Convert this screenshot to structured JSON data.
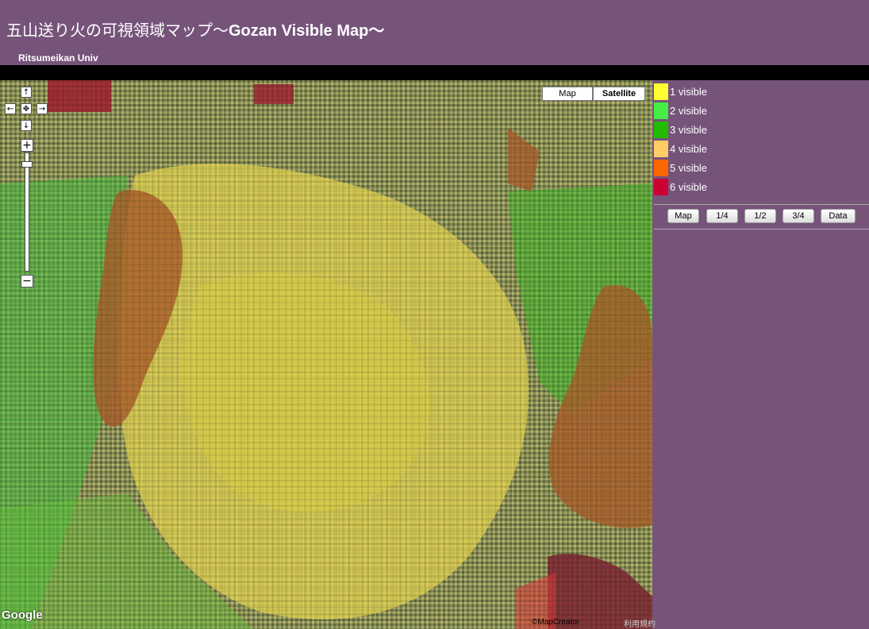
{
  "header": {
    "title_jp": "五山送り火の可視領域マップ〜",
    "title_en": "Gozan Visible Map〜",
    "subtitle": "Ritsumeikan Univ"
  },
  "map": {
    "type_buttons": [
      "Map",
      "Satellite"
    ],
    "selected_type": "Satellite",
    "pan_up_icon": "↑",
    "pan_down_icon": "↓",
    "pan_left_icon": "←",
    "pan_right_icon": "→",
    "pan_center_icon": "✥",
    "zoom_in_icon": "+",
    "zoom_out_icon": "−",
    "logo": "Google",
    "attribution": "©MapCreator",
    "terms_link": "利用規約"
  },
  "legend": [
    {
      "label": "1 visible",
      "color": "#ffff33"
    },
    {
      "label": "2 visible",
      "color": "#44ee44"
    },
    {
      "label": "3 visible",
      "color": "#22bb00"
    },
    {
      "label": "4 visible",
      "color": "#ffcc66"
    },
    {
      "label": "5 visible",
      "color": "#ff6600"
    },
    {
      "label": "6 visible",
      "color": "#cc0033"
    }
  ],
  "filter_buttons": [
    "Map",
    "1/4",
    "1/2",
    "3/4",
    "Data"
  ]
}
